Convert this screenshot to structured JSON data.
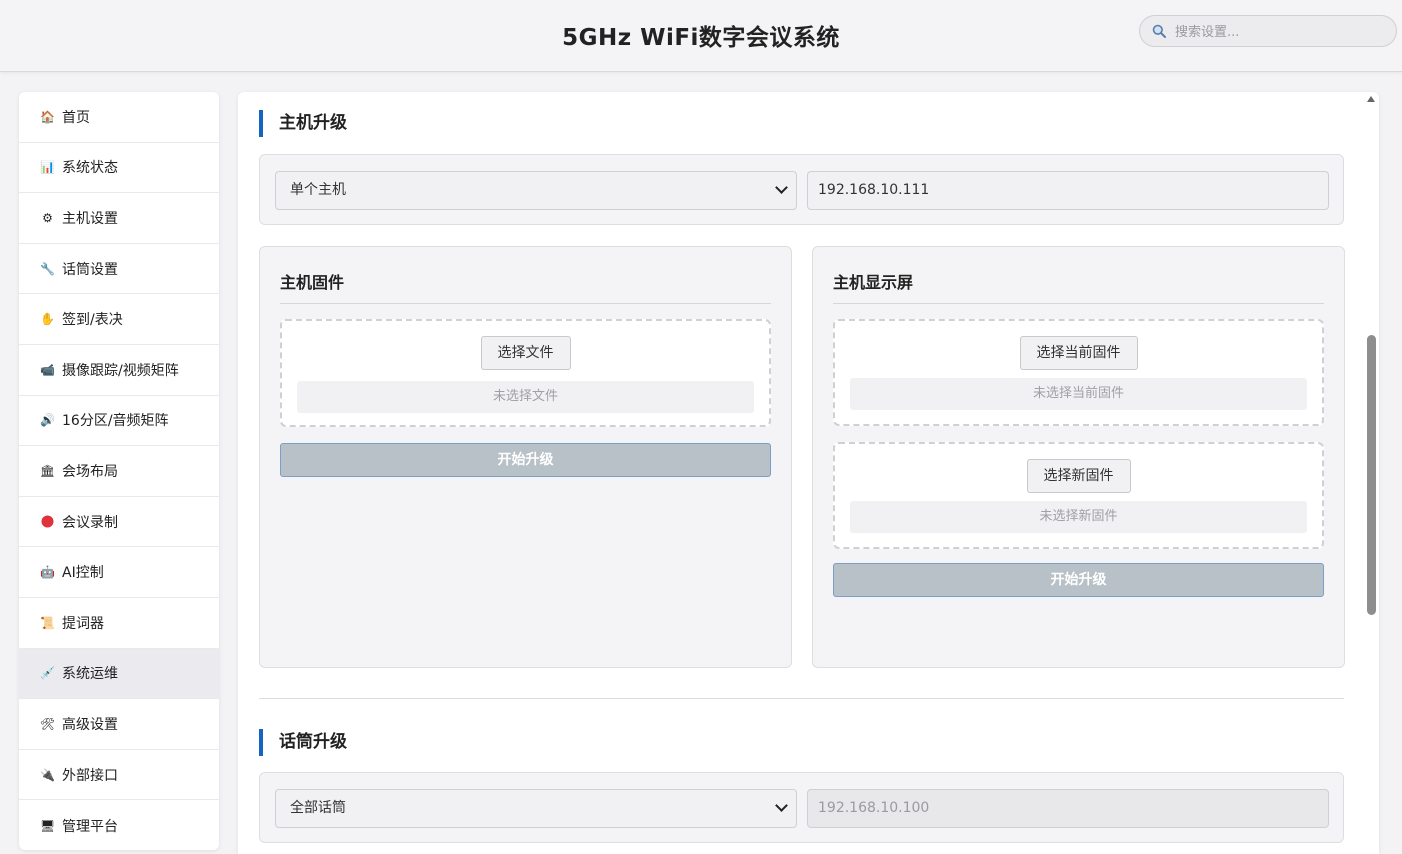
{
  "header": {
    "title": "5GHz WiFi数字会议系统",
    "search_placeholder": "搜索设置..."
  },
  "sidebar": {
    "items": [
      {
        "label": "首页",
        "icon": "house-icon"
      },
      {
        "label": "系统状态",
        "icon": "bar-chart-icon"
      },
      {
        "label": "主机设置",
        "icon": "gear-icon"
      },
      {
        "label": "话筒设置",
        "icon": "wrench-icon"
      },
      {
        "label": "签到/表决",
        "icon": "hand-icon"
      },
      {
        "label": "摄像跟踪/视频矩阵",
        "icon": "camera-icon"
      },
      {
        "label": "16分区/音频矩阵",
        "icon": "speaker-icon"
      },
      {
        "label": "会场布局",
        "icon": "building-icon"
      },
      {
        "label": "会议录制",
        "icon": "record-dot-icon"
      },
      {
        "label": "AI控制",
        "icon": "robot-icon"
      },
      {
        "label": "提词器",
        "icon": "scroll-icon"
      },
      {
        "label": "系统运维",
        "icon": "tools-icon",
        "active": true
      },
      {
        "label": "高级设置",
        "icon": "hammer-wrench-icon"
      },
      {
        "label": "外部接口",
        "icon": "plug-icon"
      },
      {
        "label": "管理平台",
        "icon": "monitor-icon"
      }
    ]
  },
  "host_upgrade": {
    "title": "主机升级",
    "select_value": "单个主机",
    "ip_value": "192.168.10.111",
    "firmware_card": {
      "title": "主机固件",
      "choose_button": "选择文件",
      "status": "未选择文件",
      "start_button": "开始升级"
    },
    "display_card": {
      "title": "主机显示屏",
      "current_button": "选择当前固件",
      "current_status": "未选择当前固件",
      "new_button": "选择新固件",
      "new_status": "未选择新固件",
      "start_button": "开始升级"
    }
  },
  "mic_upgrade": {
    "title": "话筒升级",
    "select_value": "全部话筒",
    "ip_value": "192.168.10.100"
  },
  "colors": {
    "accent": "#1565c0",
    "disabled_button": "#b8c1c7"
  }
}
